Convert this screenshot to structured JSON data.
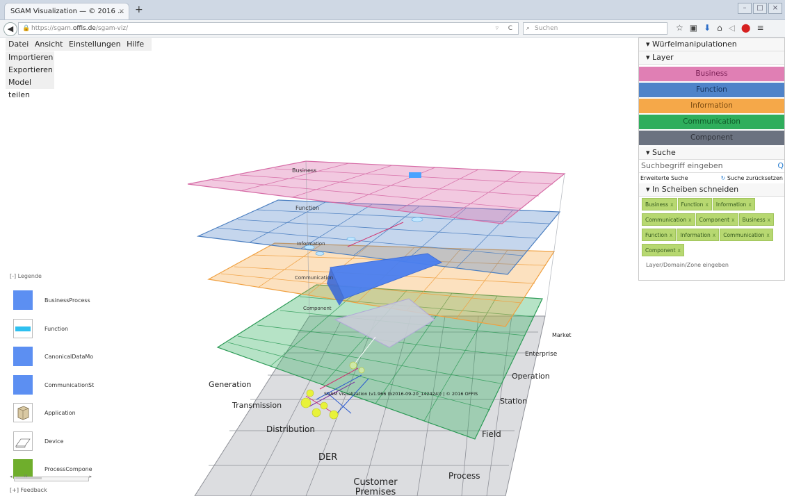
{
  "browser": {
    "tab_title": "SGAM Visualization — © 2016 ...",
    "tab_close": "×",
    "new_tab": "+",
    "url_prefix": "https://sgam.",
    "url_domain": "offis.de",
    "url_path": "/sgam-viz/",
    "search_placeholder": "Suchen",
    "toolbar_icons": [
      "star-icon",
      "clipboard-icon",
      "download-icon",
      "home-icon",
      "share-icon",
      "stop-icon",
      "menu-icon"
    ]
  },
  "menu": {
    "items": [
      "Datei",
      "Ansicht",
      "Einstellungen",
      "Hilfe"
    ],
    "file_submenu": [
      "Importieren",
      "Exportieren",
      "Model teilen"
    ]
  },
  "panel": {
    "cube_header": "Würfelmanipulationen",
    "layer_header": "Layer",
    "layers": [
      {
        "label": "Business",
        "color": "#e07fb4",
        "text": "#7a1f55"
      },
      {
        "label": "Function",
        "color": "#4f83c9",
        "text": "#16345e"
      },
      {
        "label": "Information",
        "color": "#f5a849",
        "text": "#7a4a10"
      },
      {
        "label": "Communication",
        "color": "#2fae5c",
        "text": "#0f5a2a"
      },
      {
        "label": "Component",
        "color": "#6b7280",
        "text": "#2e3138"
      }
    ],
    "search_header": "Suche",
    "search_placeholder": "Suchbegriff eingeben",
    "advanced_search": "Erweiterte Suche",
    "reset_search": "Suche zurücksetzen",
    "slice_header": "In Scheiben schneiden",
    "slice_tags": [
      "Business",
      "Function",
      "Information",
      "Communication",
      "Component",
      "Business",
      "Function",
      "Information",
      "Communication",
      "Component"
    ],
    "slice_input_placeholder": "Layer/Domain/Zone eingeben"
  },
  "legend": {
    "header": "[-] Legende",
    "items": [
      {
        "label": "BusinessProcess",
        "icon": "business-process-icon"
      },
      {
        "label": "Function",
        "icon": "function-icon"
      },
      {
        "label": "CanonicalDataMo",
        "icon": "canonical-data-model-icon"
      },
      {
        "label": "CommunicationSt",
        "icon": "communication-standard-icon"
      },
      {
        "label": "Application",
        "icon": "application-icon"
      },
      {
        "label": "Device",
        "icon": "device-icon"
      },
      {
        "label": "ProcessCompone",
        "icon": "process-component-icon"
      }
    ],
    "scroll_thumb": "III",
    "feedback": "[+] Feedback"
  },
  "cube": {
    "layer_labels": [
      "Business",
      "Function",
      "Information",
      "Communication",
      "Component"
    ],
    "domains": [
      "Generation",
      "Transmission",
      "Distribution",
      "DER",
      "Customer Premises"
    ],
    "zones": [
      "Market",
      "Enterprise",
      "Operation",
      "Station",
      "Field",
      "Process"
    ],
    "watermark": "SGAM Visualization (v1.966 (b2016-09-20_142424)) | © 2016 OFFIS"
  }
}
